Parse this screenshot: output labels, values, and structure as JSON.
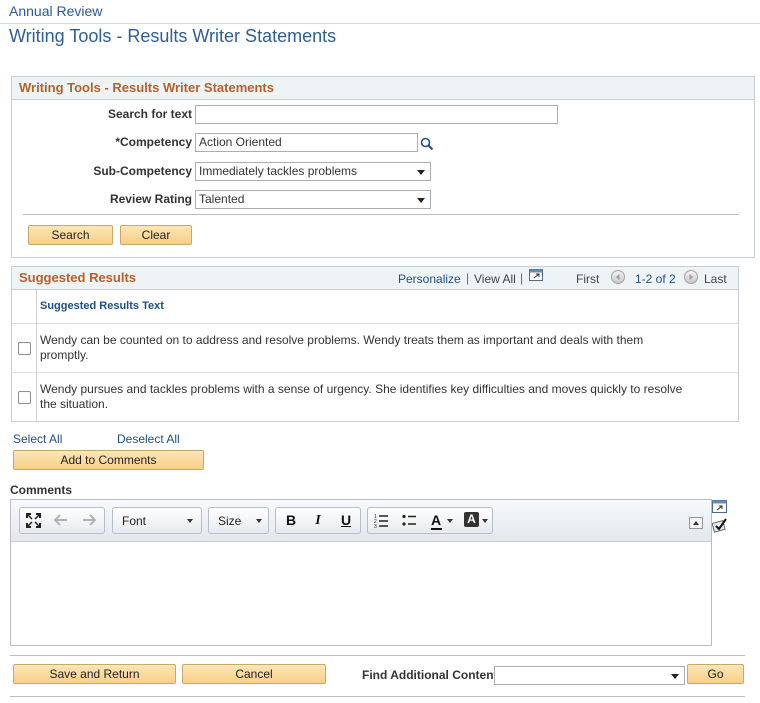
{
  "breadcrumb": "Annual Review",
  "page_title": "Writing Tools - Results Writer Statements",
  "search_box": {
    "title": "Writing Tools - Results Writer Statements",
    "search_label": "Search for text",
    "search_value": "",
    "competency_label": "*Competency",
    "competency_value": "Action Oriented",
    "subcompetency_label": "Sub-Competency",
    "subcompetency_value": "Immediately tackles problems",
    "rating_label": "Review Rating",
    "rating_value": "Talented",
    "search_button": "Search",
    "clear_button": "Clear"
  },
  "results": {
    "title": "Suggested Results",
    "personalize": "Personalize",
    "view_all": "View All",
    "first": "First",
    "range": "1-2 of 2",
    "last": "Last",
    "column_header": "Suggested Results Text",
    "rows": [
      {
        "text": "Wendy can be counted on to address and resolve problems. Wendy  treats them as important and deals with them promptly.",
        "checked": false
      },
      {
        "text": "Wendy pursues and tackles problems with a sense of urgency. She identifies key difficulties and moves quickly to resolve the situation.",
        "checked": false
      }
    ]
  },
  "select_all": "Select All",
  "deselect_all": "Deselect All",
  "add_to_comments": "Add to Comments",
  "comments": {
    "label": "Comments",
    "value": "",
    "toolbar": {
      "font": "Font",
      "size": "Size",
      "bold": "B",
      "italic": "I",
      "underline": "U",
      "text_color": "A",
      "bg_color": "A"
    }
  },
  "footer": {
    "save_return": "Save and Return",
    "cancel": "Cancel",
    "find_label": "Find Additional Content",
    "find_value": "",
    "go": "Go"
  },
  "colors": {
    "accent_title": "#b5612a",
    "link": "#1d4f87",
    "button": "#f7cf87"
  }
}
